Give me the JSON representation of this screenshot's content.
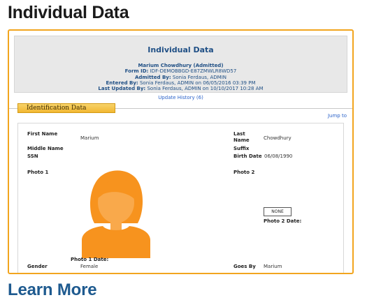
{
  "page": {
    "heading": "Individual Data",
    "learn_more": "Learn More"
  },
  "header": {
    "title": "Individual Data",
    "name_line": "Marium Chowdhury (Admitted)",
    "form_id_label": "Form ID:",
    "form_id_value": "IDF-DEMOBBGD-E87ZMWLR8WD57",
    "admitted_by_label": "Admitted By:",
    "admitted_by_value": "Sonia Ferdaus, ADMIN",
    "entered_by_label": "Entered By:",
    "entered_by_value": "Sonia Ferdaus, ADMIN on 06/05/2016 03:39 PM",
    "last_updated_label": "Last Updated By:",
    "last_updated_value": "Sonia Ferdaus, ADMIN on 10/10/2017 10:28 AM"
  },
  "update_history": "Update History (6)",
  "section": {
    "tab_label": "Identification Data",
    "jump_to": "Jump to"
  },
  "fields": {
    "first_name_label": "First Name",
    "first_name_value": "Marium",
    "last_name_label": "Last Name",
    "last_name_value": "Chowdhury",
    "middle_name_label": "Middle Name",
    "suffix_label": "Suffix",
    "ssn_label": "SSN",
    "birth_date_label": "Birth Date",
    "birth_date_value": "06/08/1990",
    "photo1_label": "Photo 1",
    "photo2_label": "Photo 2",
    "photo2_value": "NONE",
    "photo2_date_label": "Photo 2 Date:",
    "photo1_date_label": "Photo 1 Date:",
    "gender_label": "Gender",
    "gender_value": "Female",
    "goes_by_label": "Goes By",
    "goes_by_value": "Marium"
  },
  "colors": {
    "accent": "#f2a51e",
    "link": "#2a62c9",
    "header_text": "#1f4f85",
    "avatar": "#f7931e"
  }
}
